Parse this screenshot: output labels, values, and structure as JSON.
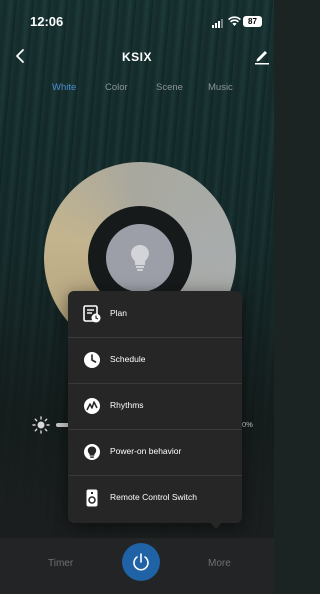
{
  "status_bar": {
    "time": "12:06",
    "battery": "87"
  },
  "nav": {
    "title": "KSIX"
  },
  "tabs": [
    {
      "label": "White",
      "active": true
    },
    {
      "label": "Color",
      "active": false
    },
    {
      "label": "Scene",
      "active": false
    },
    {
      "label": "Music",
      "active": false
    }
  ],
  "brightness": {
    "percent_text": "0%"
  },
  "menu": {
    "items": [
      {
        "label": "Plan",
        "icon": "plan-icon"
      },
      {
        "label": "Schedule",
        "icon": "clock-icon"
      },
      {
        "label": "Rhythms",
        "icon": "rhythms-icon"
      },
      {
        "label": "Power-on behavior",
        "icon": "bulb-icon"
      },
      {
        "label": "Remote Control Switch",
        "icon": "remote-icon"
      }
    ]
  },
  "bottom": {
    "timer_label": "Timer",
    "more_label": "More"
  },
  "colors": {
    "accent": "#1f62a5",
    "tab_active": "#4d8fd0",
    "menu_bg": "#262626"
  }
}
